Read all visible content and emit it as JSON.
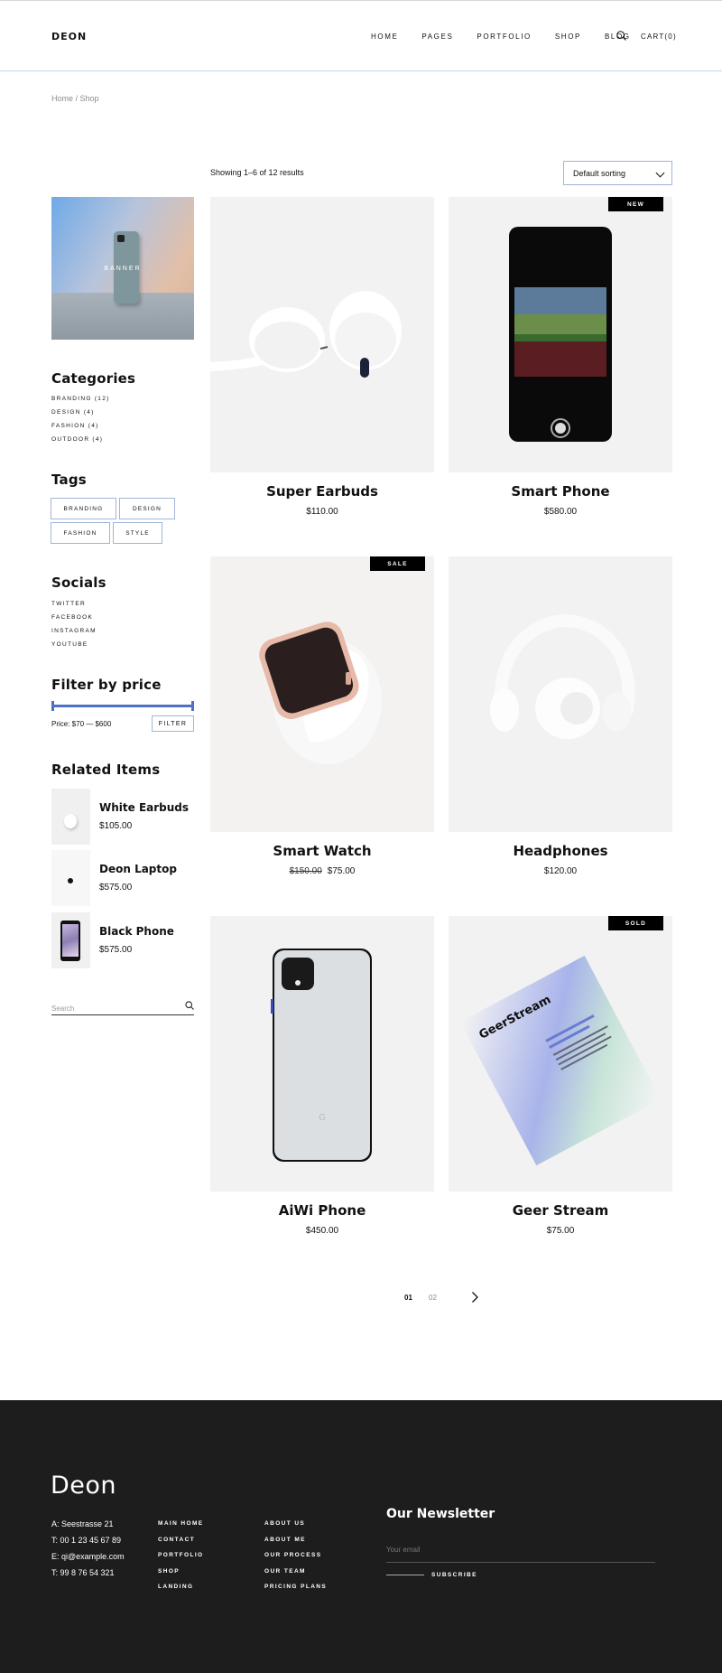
{
  "header": {
    "logo": "DEON",
    "nav": [
      "HOME",
      "PAGES",
      "PORTFOLIO",
      "SHOP",
      "BLOG"
    ],
    "cart": "CART(0)",
    "icon": "search-icon"
  },
  "breadcrumb": "Home / Shop",
  "sidebar": {
    "banner_text": "BANNER",
    "categories": {
      "title": "Categories",
      "items": [
        "BRANDING (12)",
        "DESIGN (4)",
        "FASHION (4)",
        "OUTDOOR (4)"
      ]
    },
    "tags": {
      "title": "Tags",
      "items": [
        "BRANDING",
        "DESIGN",
        "FASHION",
        "STYLE"
      ]
    },
    "socials": {
      "title": "Socials",
      "items": [
        "TWITTER",
        "FACEBOOK",
        "INSTAGRAM",
        "YOUTUBE"
      ]
    },
    "filter": {
      "title": "Filter by price",
      "range_text": "Price: $70 — $600",
      "button": "FILTER",
      "accent_color": "#4f70c7"
    },
    "related": {
      "title": "Related Items",
      "items": [
        {
          "name": "White Earbuds",
          "price": "$105.00"
        },
        {
          "name": "Deon Laptop",
          "price": "$575.00"
        },
        {
          "name": "Black Phone",
          "price": "$575.00"
        }
      ]
    },
    "search_placeholder": "Search"
  },
  "shop": {
    "showing": "Showing 1–6 of 12 results",
    "sorting": "Default sorting",
    "products": [
      {
        "title": "Super Earbuds",
        "price": "$110.00",
        "old_price": "",
        "badge": ""
      },
      {
        "title": "Smart Phone",
        "price": "$580.00",
        "old_price": "",
        "badge": "NEW"
      },
      {
        "title": "Smart Watch",
        "price": "$75.00",
        "old_price": "$150.00",
        "badge": "SALE"
      },
      {
        "title": "Headphones",
        "price": "$120.00",
        "old_price": "",
        "badge": ""
      },
      {
        "title": "AiWi Phone",
        "price": "$450.00",
        "old_price": "",
        "badge": ""
      },
      {
        "title": "Geer Stream",
        "price": "$75.00",
        "old_price": "",
        "badge": "SOLD"
      }
    ],
    "product_image_text": {
      "paper_brand": "GeerStream"
    },
    "pagination": {
      "pages": [
        "01",
        "02"
      ],
      "current": "01"
    }
  },
  "footer": {
    "logo": "Deon",
    "contact": [
      "A: Seestrasse 21",
      "T: 00 1 23 45 67 89",
      "E: qi@example.com",
      "T: 99 8 76 54 321"
    ],
    "col1": [
      "MAIN HOME",
      "CONTACT",
      "PORTFOLIO",
      "SHOP",
      "LANDING"
    ],
    "col2": [
      "ABOUT US",
      "ABOUT ME",
      "OUR PROCESS",
      "OUR TEAM",
      "PRICING PLANS"
    ],
    "newsletter_title": "Our Newsletter",
    "email_placeholder": "Your email",
    "subscribe": "SUBSCRIBE",
    "background": "#1d1d1d"
  }
}
